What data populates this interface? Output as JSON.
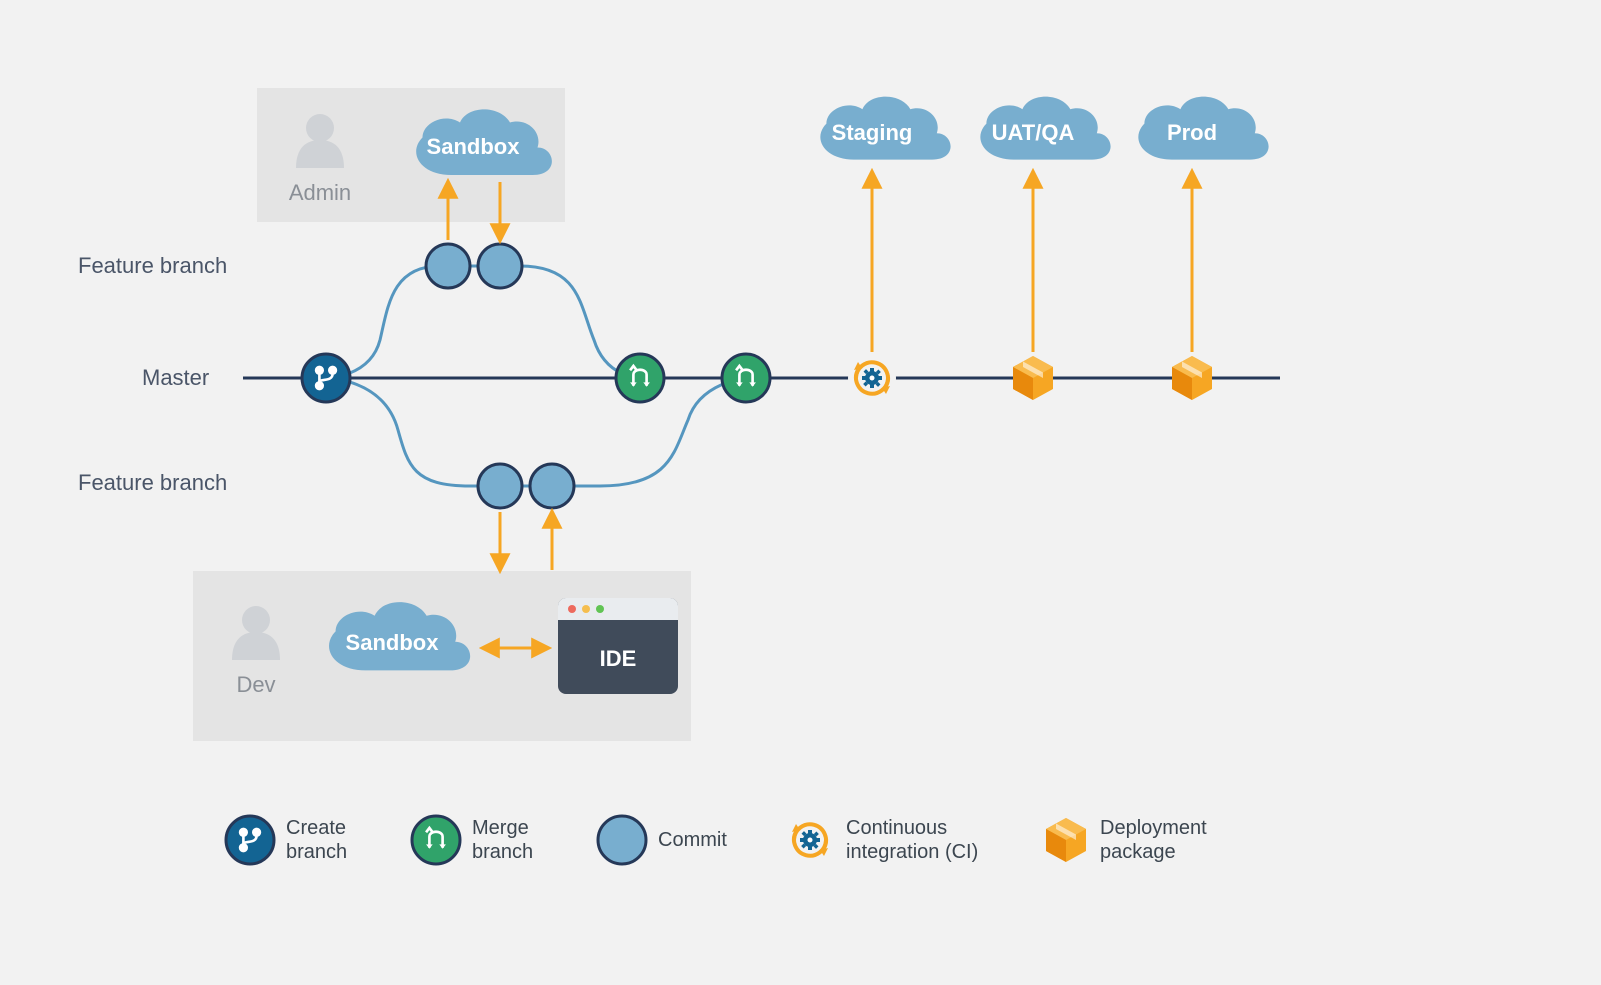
{
  "labels": {
    "feature_branch_top": "Feature branch",
    "master": "Master",
    "feature_branch_bottom": "Feature branch"
  },
  "roles": {
    "admin": "Admin",
    "dev": "Dev"
  },
  "clouds": {
    "sandbox_admin": "Sandbox",
    "sandbox_dev": "Sandbox",
    "staging": "Staging",
    "uat_qa": "UAT/QA",
    "prod": "Prod"
  },
  "ide": {
    "label": "IDE"
  },
  "legend": {
    "create_branch_l1": "Create",
    "create_branch_l2": "branch",
    "merge_branch_l1": "Merge",
    "merge_branch_l2": "branch",
    "commit": "Commit",
    "ci_l1": "Continuous",
    "ci_l2": "integration (CI)",
    "package_l1": "Deployment",
    "package_l2": "package"
  },
  "colors": {
    "bg": "#f2f2f2",
    "panel": "#e4e4e4",
    "dark_navy": "#253858",
    "blue_dark": "#136493",
    "blue_mid": "#5596bf",
    "blue_light": "#78aecf",
    "green": "#30a36a",
    "orange": "#f6a623",
    "orange_dark": "#e8890c",
    "gray_icon": "#cfd2d6",
    "gray_text": "#8a8f96",
    "label_text": "#4a5568",
    "ide_body": "#404b5a",
    "ide_head": "#e9ecef"
  }
}
